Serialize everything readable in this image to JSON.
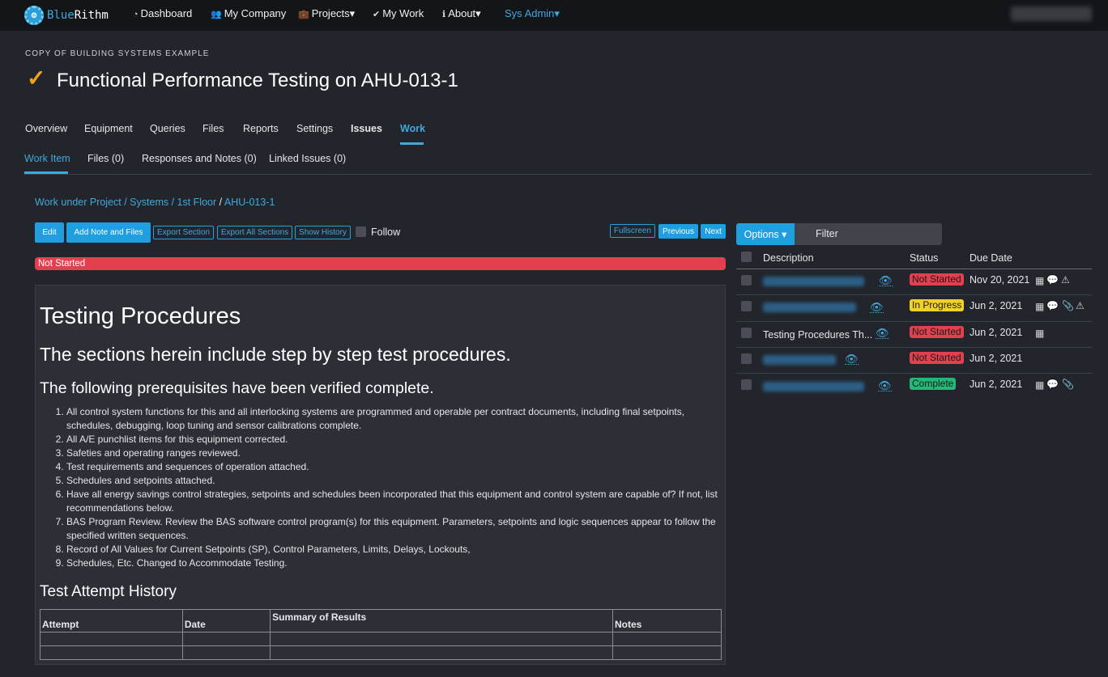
{
  "nav": {
    "logo": {
      "blue": "Blue",
      "white": "Rithm"
    },
    "items": [
      {
        "icon": "dashboard-icon",
        "glyph": "◔",
        "label": "Dashboard"
      },
      {
        "icon": "users-icon",
        "glyph": "👥",
        "label": "My Company"
      },
      {
        "icon": "briefcase-icon",
        "glyph": "💼",
        "label": "Projects▾"
      },
      {
        "icon": "check-icon",
        "glyph": "✔",
        "label": "My Work"
      },
      {
        "icon": "info-icon",
        "glyph": "ℹ",
        "label": "About▾"
      },
      {
        "icon": "",
        "glyph": "",
        "label": "Sys Admin▾"
      }
    ]
  },
  "header": {
    "project": "COPY OF BUILDING SYSTEMS EXAMPLE",
    "title": "Functional Performance Testing on AHU-013-1"
  },
  "tabs": [
    "Overview",
    "Equipment",
    "Queries",
    "Files",
    "Reports",
    "Settings",
    "Issues",
    "Work"
  ],
  "subtabs": [
    "Work Item",
    "Files (0)",
    "Responses and Notes (0)",
    "Linked Issues (0)"
  ],
  "breadcrumb": {
    "part1": "Work under Project / Systems / 1st Floor",
    "sep": " / ",
    "part2": "AHU-013-1"
  },
  "toolbar": {
    "edit": "Edit",
    "add_note": "Add Note and Files",
    "export_section": "Export Section",
    "export_all": "Export All Sections",
    "show_history": "Show History",
    "follow": "Follow",
    "fullscreen": "Fullscreen",
    "previous": "Previous",
    "next": "Next"
  },
  "status": "Not Started",
  "content": {
    "h1": "Testing Procedures",
    "h2": "The sections herein include step by step test procedures.",
    "h3": "The following prerequisites have been verified complete.",
    "items": [
      "All control system functions for this and all interlocking systems are programmed and operable per contract documents, including final setpoints, schedules, debugging, loop tuning and sensor calibrations complete.",
      "All A/E punchlist items for this equipment corrected.",
      "Safeties and operating ranges reviewed.",
      "Test requirements and sequences of operation attached.",
      "Schedules and setpoints attached.",
      "Have all energy savings control strategies, setpoints and schedules been incorporated that this equipment and control system are capable of?  If not, list recommendations below.",
      "BAS Program Review.  Review the BAS software control program(s) for this equipment.   Parameters, setpoints and logic sequences appear to follow the specified written sequences.",
      "Record of All Values for Current Setpoints (SP), Control Parameters, Limits, Delays, Lockouts,",
      "Schedules, Etc. Changed to Accommodate Testing."
    ],
    "history_title": "Test Attempt History",
    "history_cols": [
      "Attempt",
      "Date",
      "Summary of Results",
      "Notes"
    ]
  },
  "panel": {
    "options": "Options ▾",
    "filter": "Filter",
    "cols": {
      "description": "Description",
      "status": "Status",
      "due": "Due Date"
    },
    "rows": [
      {
        "description": "",
        "status": "Not Started",
        "due": "Nov 20, 2021"
      },
      {
        "description": "",
        "status": "In Progress",
        "due": "Jun 2, 2021"
      },
      {
        "description": "Testing Procedures Th...",
        "status": "Not Started",
        "due": "Jun 2, 2021"
      },
      {
        "description": "",
        "status": "Not Started",
        "due": "Jun 2, 2021"
      },
      {
        "description": "",
        "status": "Complete",
        "due": "Jun 2, 2021"
      }
    ]
  },
  "colors": {
    "accent": "#3fa9dc",
    "danger": "#e3404f",
    "warning": "#f1d02a",
    "success": "#22b877",
    "check": "#f0a21b"
  }
}
